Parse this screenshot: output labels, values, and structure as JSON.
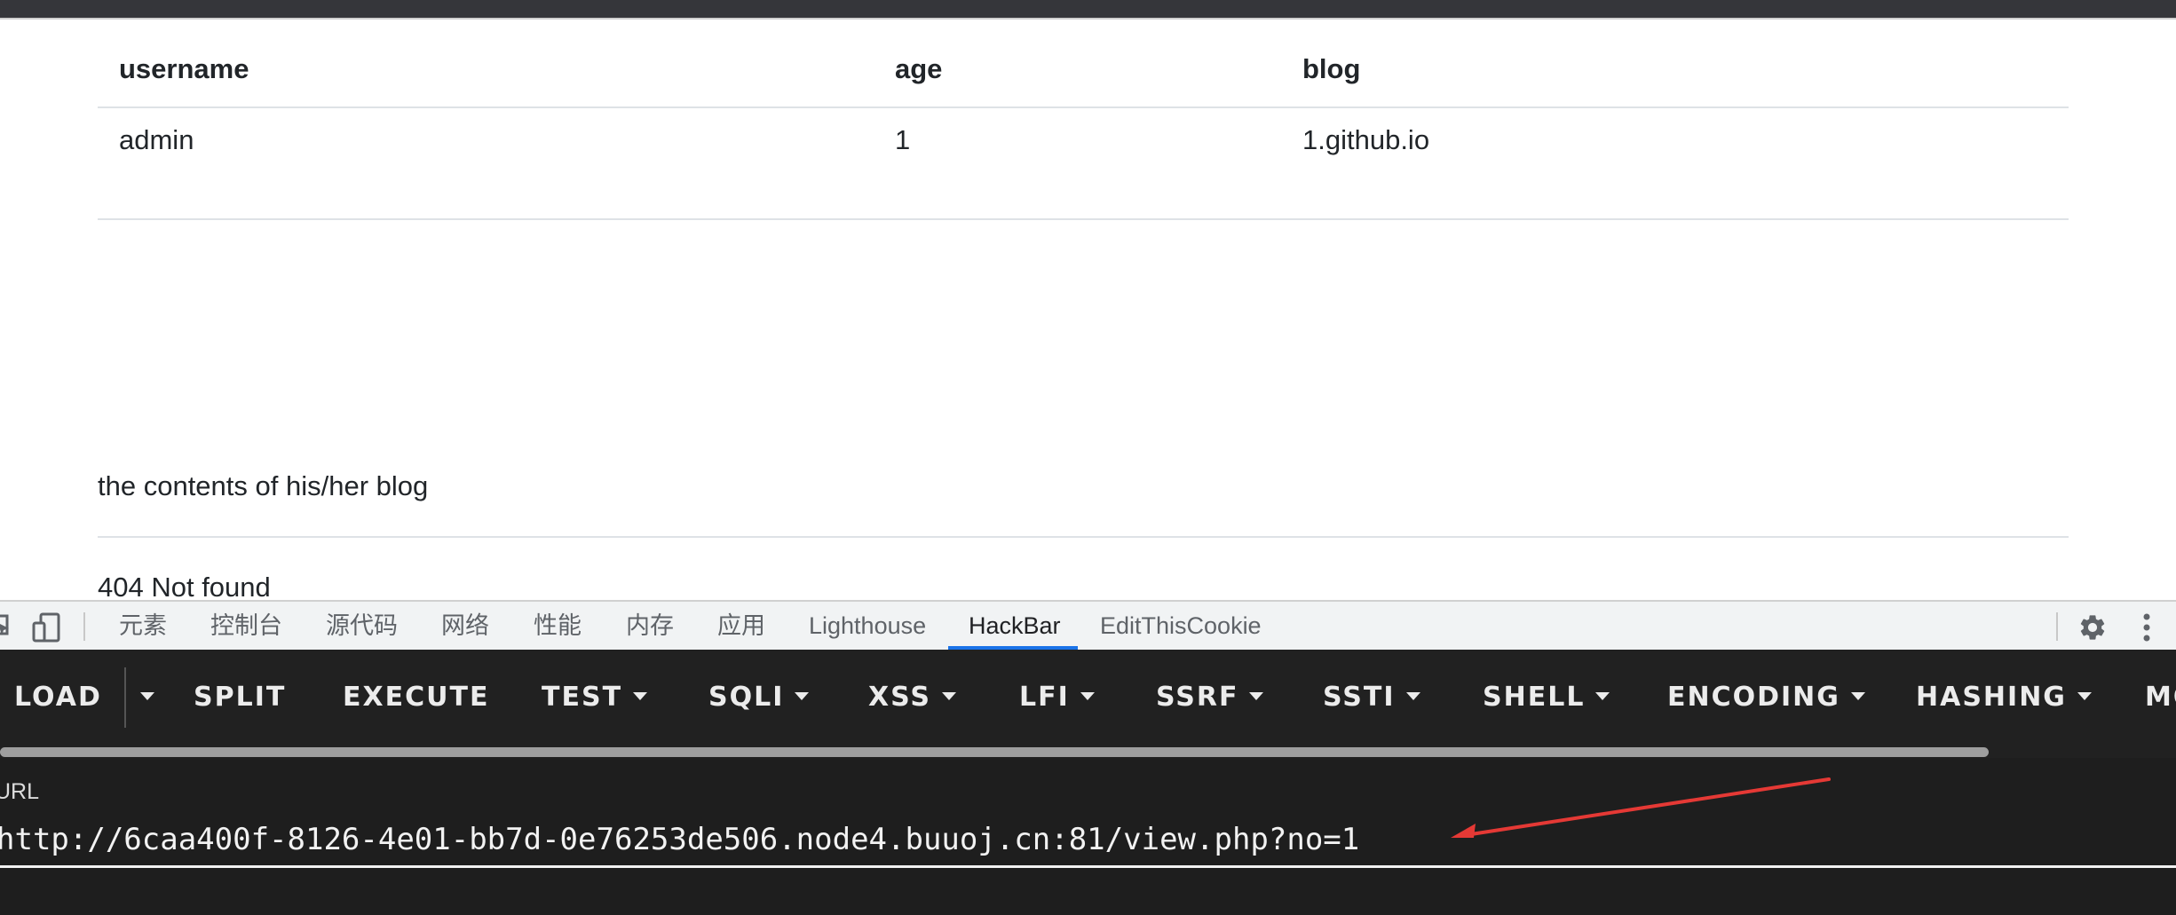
{
  "web": {
    "table": {
      "headers": [
        "username",
        "age",
        "blog"
      ],
      "rows": [
        [
          "admin",
          "1",
          "1.github.io"
        ]
      ]
    },
    "blog_heading": "the contents of his/her blog",
    "blog_content": "404 Not found"
  },
  "devtools": {
    "tabs": [
      "元素",
      "控制台",
      "源代码",
      "网络",
      "性能",
      "内存",
      "应用",
      "Lighthouse",
      "HackBar",
      "EditThisCookie"
    ],
    "active_tab": "HackBar",
    "icons": [
      "inspect-icon",
      "device-toolbar-icon",
      "gear-icon",
      "more-vertical-icon"
    ],
    "accent_color": "#1a73e8"
  },
  "hackbar": {
    "buttons": {
      "load": "LOAD",
      "split": "SPLIT",
      "execute": "EXECUTE",
      "test": "TEST",
      "sqli": "SQLI",
      "xss": "XSS",
      "lfi": "LFI",
      "ssrf": "SSRF",
      "ssti": "SSTI",
      "shell": "SHELL",
      "encoding": "ENCODING",
      "hashing": "HASHING",
      "more": "MO"
    },
    "url_label": "URL",
    "url_value": "http://6caa400f-8126-4e01-bb7d-0e76253de506.node4.buuoj.cn:81/view.php?no=1",
    "annotation_arrow_color": "#e53935"
  }
}
